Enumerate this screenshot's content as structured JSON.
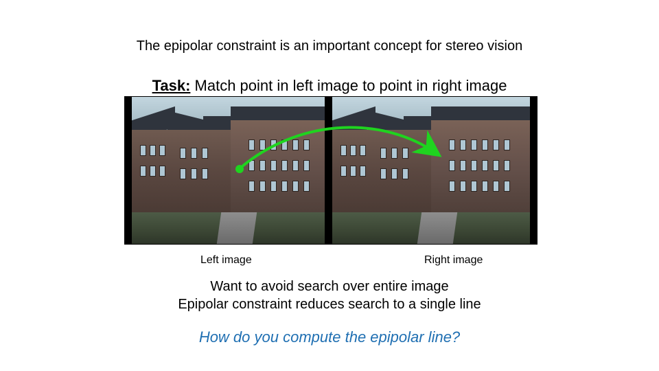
{
  "title": "The epipolar constraint is an important concept for stereo vision",
  "task_label": "Task:",
  "task_text": " Match point in left image to point in right image",
  "captions": {
    "left": "Left image",
    "right": "Right image"
  },
  "body": {
    "line1": "Want to avoid search over entire image",
    "line2": "Epipolar constraint reduces search to a single line"
  },
  "question": "How do you compute the epipolar line?",
  "colors": {
    "question": "#1f6fb2",
    "arrow": "#1fd41f"
  }
}
